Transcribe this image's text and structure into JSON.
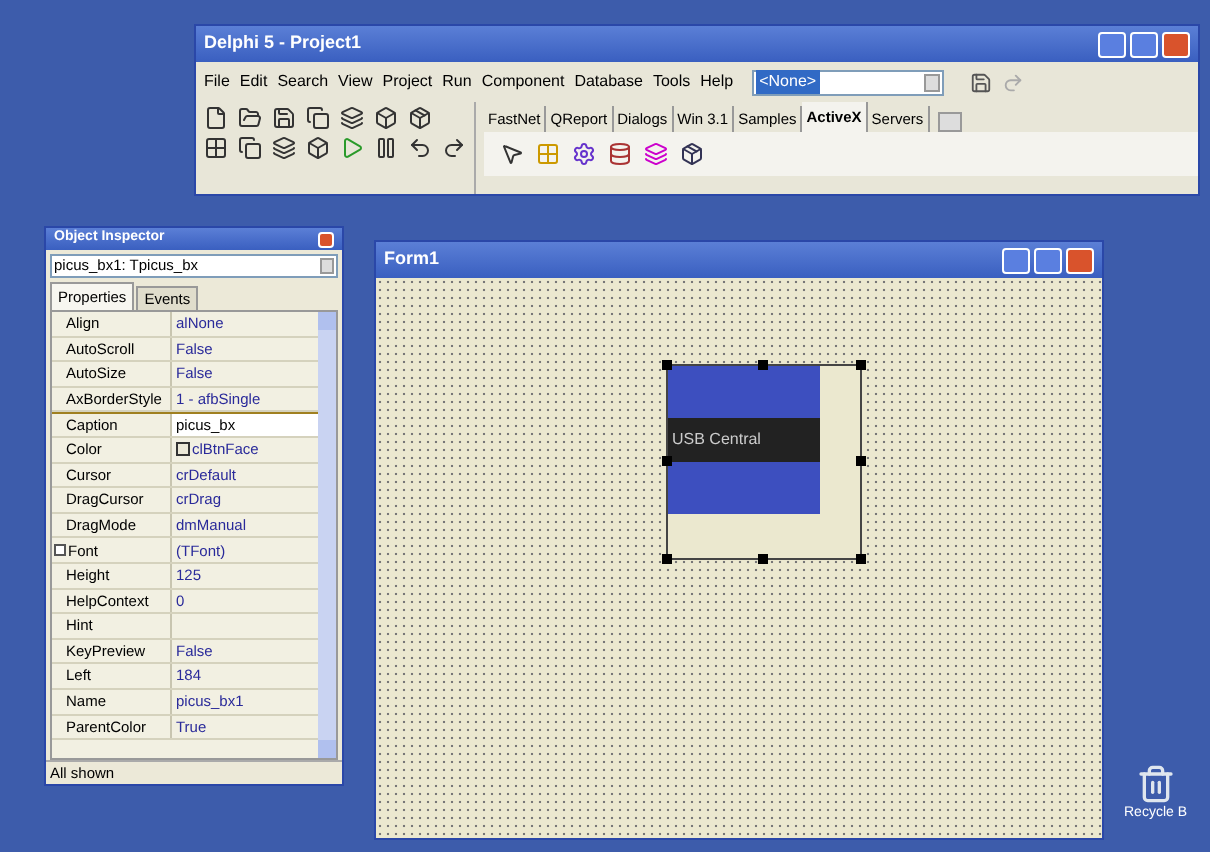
{
  "main_window": {
    "title": "Delphi 5 - Project1",
    "menu": [
      "File",
      "Edit",
      "Search",
      "View",
      "Project",
      "Run",
      "Component",
      "Database",
      "Tools",
      "Help"
    ],
    "desktop_combo": {
      "value": "<None>"
    },
    "palette_tabs": [
      {
        "label": "FastNet",
        "selected": false
      },
      {
        "label": "QReport",
        "selected": false
      },
      {
        "label": "Dialogs",
        "selected": false
      },
      {
        "label": "Win 3.1",
        "selected": false
      },
      {
        "label": "Samples",
        "selected": false
      },
      {
        "label": "ActiveX",
        "selected": true
      },
      {
        "label": "Servers",
        "selected": false
      }
    ]
  },
  "object_inspector": {
    "title": "Object Inspector",
    "object_combo": {
      "value": "picus_bx1: Tpicus_bx"
    },
    "tabs": [
      {
        "label": "Properties",
        "selected": true
      },
      {
        "label": "Events",
        "selected": false
      }
    ],
    "properties": [
      {
        "name": "Align",
        "value": "alNone",
        "kind": "text",
        "selected": false
      },
      {
        "name": "AutoScroll",
        "value": "False",
        "kind": "text",
        "selected": false
      },
      {
        "name": "AutoSize",
        "value": "False",
        "kind": "text",
        "selected": false
      },
      {
        "name": "AxBorderStyle",
        "value": "1 - afbSingle",
        "kind": "text",
        "selected": false
      },
      {
        "name": "Caption",
        "value": "picus_bx",
        "kind": "text",
        "selected": true
      },
      {
        "name": "Color",
        "value": "clBtnFace",
        "kind": "color",
        "selected": false
      },
      {
        "name": "Cursor",
        "value": "crDefault",
        "kind": "text",
        "selected": false
      },
      {
        "name": "DragCursor",
        "value": "crDrag",
        "kind": "text",
        "selected": false
      },
      {
        "name": "DragMode",
        "value": "dmManual",
        "kind": "text",
        "selected": false
      },
      {
        "name": "Font",
        "value": "(TFont)",
        "kind": "group",
        "selected": false
      },
      {
        "name": "Height",
        "value": "125",
        "kind": "text",
        "selected": false
      },
      {
        "name": "HelpContext",
        "value": "0",
        "kind": "text",
        "selected": false
      },
      {
        "name": "Hint",
        "kind": "text",
        "selected": false
      },
      {
        "name": "KeyPreview",
        "value": "False",
        "kind": "text",
        "selected": false
      },
      {
        "name": "Left",
        "value": "184",
        "kind": "text",
        "selected": false
      },
      {
        "name": "Name",
        "value": "picus_bx1",
        "kind": "text",
        "selected": false
      },
      {
        "name": "ParentColor",
        "value": "True",
        "kind": "text",
        "selected": false
      }
    ],
    "status": "All shown"
  },
  "form_window": {
    "title": "Form1",
    "component_caption": "USB Central"
  },
  "desktop": {
    "recycle_bin_label": "Recycle B"
  }
}
